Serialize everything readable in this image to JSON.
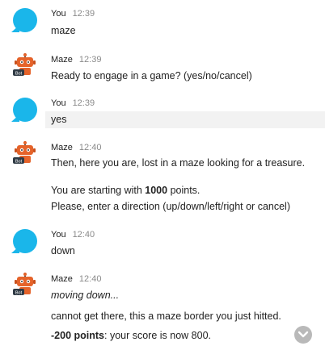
{
  "conversation": {
    "m1": {
      "sender": "You",
      "time": "12:39",
      "text": "maze"
    },
    "m2": {
      "sender": "Maze",
      "time": "12:39",
      "badge": "Bot",
      "text": "Ready to engage in a game? (yes/no/cancel)"
    },
    "m3": {
      "sender": "You",
      "time": "12:39",
      "text": "yes"
    },
    "m4": {
      "sender": "Maze",
      "time": "12:40",
      "badge": "Bot",
      "line1": "Then, here you are, lost in a maze looking for a treasure.",
      "line2_prefix": "You are starting with ",
      "line2_points": "1000",
      "line2_suffix": " points.",
      "line3": "Please, enter a direction (up/down/left/right or cancel)"
    },
    "m5": {
      "sender": "You",
      "time": "12:40",
      "text": "down"
    },
    "m6": {
      "sender": "Maze",
      "time": "12:40",
      "badge": "Bot",
      "line1": "moving down...",
      "line2": "cannot get there, this a maze border you just hitted.",
      "line3_bold": "-200 points",
      "line3_rest": ": your score is now 800."
    }
  },
  "colors": {
    "user_avatar": "#1ab6ea",
    "bot_avatar": "#e5632a",
    "highlight_row": "#f2f2f2",
    "scroll_button": "#b9b9b9"
  },
  "icons": {
    "user_avatar": "speech-bubble-icon",
    "bot_avatar": "robot-icon",
    "scroll_down": "chevron-down-icon"
  }
}
